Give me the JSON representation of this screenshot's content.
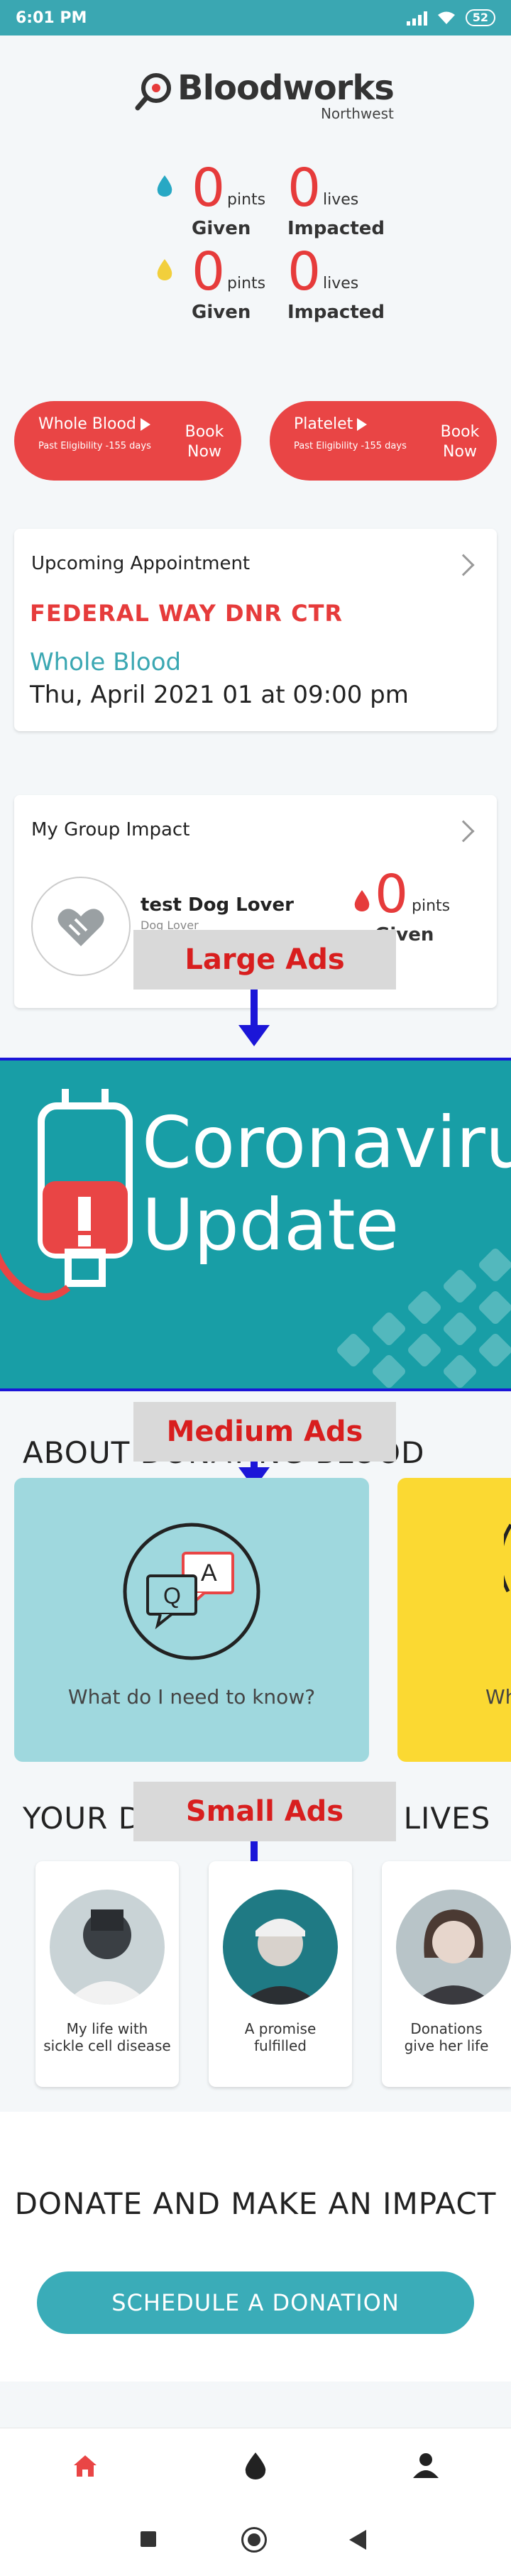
{
  "status_bar": {
    "time": "6:01 PM",
    "battery": "52"
  },
  "brand": {
    "name": "Bloodworks",
    "region": "Northwest"
  },
  "stats": [
    {
      "given_value": "0",
      "given_unit": "pints",
      "given_label": "Given",
      "lives_value": "0",
      "lives_unit": "lives",
      "lives_label": "Impacted",
      "drop_color": "#27a8c4"
    },
    {
      "given_value": "0",
      "given_unit": "pints",
      "given_label": "Given",
      "lives_value": "0",
      "lives_unit": "lives",
      "lives_label": "Impacted",
      "drop_color": "#f2cf3c"
    }
  ],
  "book": [
    {
      "title": "Whole Blood",
      "eligibility": "Past Eligibility -155 days",
      "action": "Book Now"
    },
    {
      "title": "Platelet",
      "eligibility": "Past Eligibility -155 days",
      "action": "Book Now"
    }
  ],
  "appointment": {
    "title": "Upcoming Appointment",
    "center": "FEDERAL WAY DNR CTR",
    "type": "Whole Blood",
    "date": "Thu, April 2021 01 at 09:00 pm"
  },
  "group": {
    "title": "My Group Impact",
    "name": "test Dog Lover",
    "subtitle": "Dog Lover",
    "value": "0",
    "unit": "pints",
    "label": "Given"
  },
  "ads": {
    "large": "Large Ads",
    "medium": "Medium Ads",
    "small": "Small Ads"
  },
  "banner": {
    "line1": "Coronavirus",
    "line2": "Update"
  },
  "about": {
    "heading": "ABOUT DONATING BLOOD",
    "topics": [
      {
        "question": "What do I need to know?",
        "color": "#9fd8de"
      },
      {
        "question": "Wh",
        "color": "#fbd932"
      }
    ]
  },
  "stories": {
    "heading": "YOUR DONATIONS SAVE LIVES",
    "items": [
      {
        "caption_line1": "My life with",
        "caption_line2": "sickle cell disease"
      },
      {
        "caption_line1": "A promise",
        "caption_line2": "fulfilled"
      },
      {
        "caption_line1": "Donations",
        "caption_line2": "give her life"
      }
    ]
  },
  "impact": {
    "heading": "DONATE AND MAKE AN IMPACT",
    "button": "SCHEDULE A DONATION"
  },
  "nav": {
    "items": [
      "home-icon",
      "blood-drop-icon",
      "profile-icon"
    ]
  },
  "colors": {
    "accent": "#3aacb8",
    "red": "#e63b3b",
    "ad_label_text": "#d81e1e",
    "arrow": "#1b16d8"
  }
}
